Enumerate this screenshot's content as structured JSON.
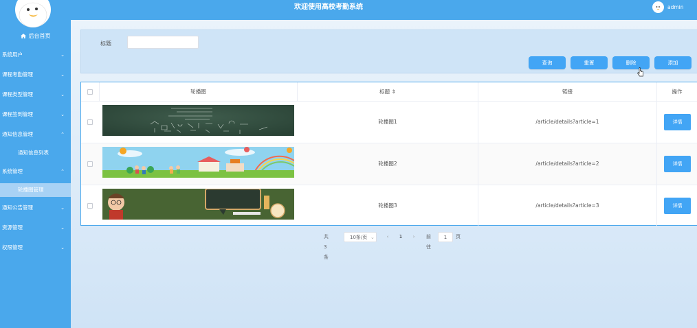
{
  "header": {
    "title": "欢迎使用高校考勤系统",
    "username": "admin"
  },
  "sidebar": {
    "home_label": "后台首页",
    "items": [
      {
        "label": "系统用户",
        "chevron": "⌄"
      },
      {
        "label": "课程考勤管理",
        "chevron": "⌄"
      },
      {
        "label": "课程类型管理",
        "chevron": "⌄"
      },
      {
        "label": "课程签到管理",
        "chevron": "⌄"
      },
      {
        "label": "通知信息管理",
        "chevron": "⌃"
      },
      {
        "label": "系统管理",
        "chevron": "⌃"
      },
      {
        "label": "通知公告管理",
        "chevron": "⌄"
      },
      {
        "label": "资源管理",
        "chevron": "⌄"
      },
      {
        "label": "权限管理",
        "chevron": "⌄"
      }
    ],
    "sub_items": [
      {
        "label": "通知信息列表"
      },
      {
        "label": "轮播图管理",
        "active": true
      }
    ]
  },
  "search": {
    "label": "标题",
    "value": "",
    "placeholder": ""
  },
  "buttons": {
    "query": "查询",
    "reset": "重置",
    "delete": "删除",
    "add": "添加"
  },
  "table": {
    "columns": [
      "轮播图",
      "标题 ⇕",
      "链接",
      "操作"
    ],
    "rows": [
      {
        "title": "轮播图1",
        "link": "/article/details?article=1",
        "action": "详情"
      },
      {
        "title": "轮播图2",
        "link": "/article/details?article=2",
        "action": "详情"
      },
      {
        "title": "轮播图3",
        "link": "/article/details?article=3",
        "action": "详情"
      }
    ]
  },
  "pagination": {
    "total_text": "共 3 条",
    "page_size": "10条/页",
    "prev": "‹",
    "current_page": "1",
    "next": "›",
    "goto_label": "前往",
    "goto_value": "1",
    "page_suffix": "页"
  },
  "colors": {
    "primary": "#4aa8ec",
    "button": "#42a5f5",
    "active_sub": "#a8d2f5"
  }
}
